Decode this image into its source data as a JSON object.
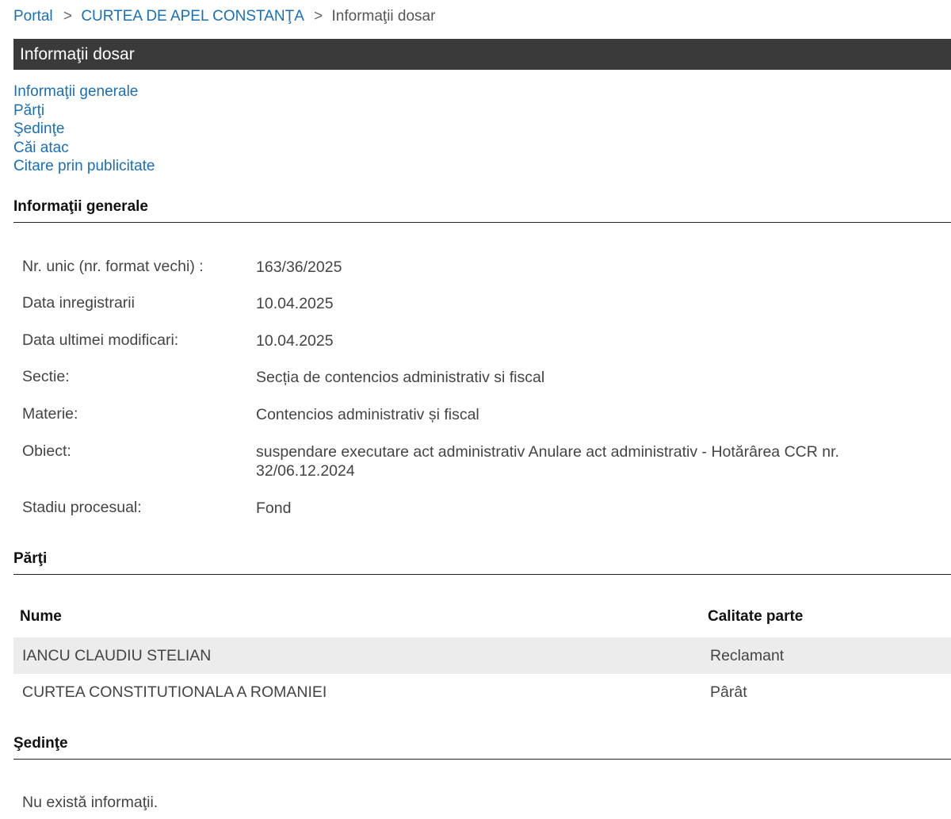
{
  "breadcrumb": {
    "portal": "Portal",
    "sep1": ">",
    "court": "CURTEA DE APEL CONSTANŢA",
    "sep2": ">",
    "current": "Informaţii dosar"
  },
  "page_title": "Informaţii dosar",
  "anchors": [
    "Informaţii generale",
    "Părţi",
    "Şedinţe",
    "Căi atac",
    "Citare prin publicitate"
  ],
  "general": {
    "heading": "Informaţii generale",
    "rows": [
      {
        "label": "Nr. unic (nr. format vechi) :",
        "value": "163/36/2025"
      },
      {
        "label": "Data inregistrarii",
        "value": "10.04.2025"
      },
      {
        "label": "Data ultimei modificari:",
        "value": "10.04.2025"
      },
      {
        "label": "Sectie:",
        "value": "Secția de contencios administrativ si fiscal"
      },
      {
        "label": "Materie:",
        "value": "Contencios administrativ și fiscal"
      },
      {
        "label": "Obiect:",
        "value": "suspendare executare act administrativ Anulare act administrativ - Hotărârea CCR nr. 32/06.12.2024"
      },
      {
        "label": "Stadiu procesual:",
        "value": "Fond"
      }
    ]
  },
  "parti": {
    "heading": "Părţi",
    "columns": [
      "Nume",
      "Calitate parte"
    ],
    "rows": [
      {
        "nume": "IANCU CLAUDIU STELIAN",
        "calitate": "Reclamant"
      },
      {
        "nume": "CURTEA CONSTITUTIONALA A ROMANIEI",
        "calitate": "Pârât"
      }
    ]
  },
  "sedinte": {
    "heading": "Şedinţe",
    "empty_text": "Nu există informaţii."
  },
  "colors": {
    "link": "#1a6fb5",
    "titlebar_bg": "#3a3a3a",
    "row_shade": "#ececec"
  }
}
